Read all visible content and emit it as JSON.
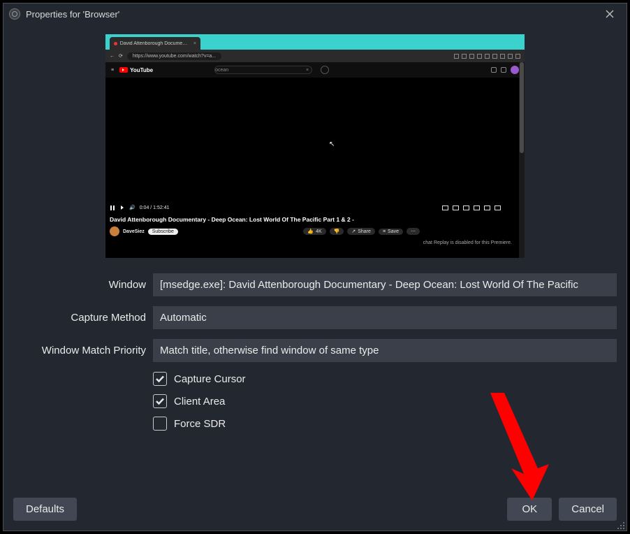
{
  "titlebar": {
    "title": "Properties for 'Browser'"
  },
  "preview": {
    "tab_title": "David Attenborough Document...",
    "url_text": "https://www.youtube.com/watch?v=a...",
    "search_text": "ocean",
    "time_text": "0:04 / 1:52:41",
    "video_title": "David Attenborough Documentary - Deep Ocean: Lost World Of The Pacific Part 1 & 2 -",
    "channel": "DaveSiez",
    "subscribe": "Subscribe",
    "like": "4K",
    "share": "Share",
    "save": "Save",
    "chat_note": "chat Replay is disabled for this Premiere."
  },
  "form": {
    "window_label": "Window",
    "window_value": "[msedge.exe]: David Attenborough Documentary - Deep Ocean: Lost World Of The Pacific",
    "capture_method_label": "Capture Method",
    "capture_method_value": "Automatic",
    "priority_label": "Window Match Priority",
    "priority_value": "Match title, otherwise find window of same type",
    "capture_cursor": "Capture Cursor",
    "client_area": "Client Area",
    "force_sdr": "Force SDR"
  },
  "footer": {
    "defaults": "Defaults",
    "ok": "OK",
    "cancel": "Cancel"
  },
  "colors": {
    "arrow": "#ff0000"
  }
}
